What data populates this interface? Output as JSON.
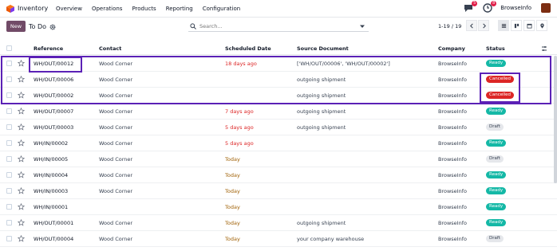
{
  "topbar": {
    "app_name": "Inventory",
    "menu": [
      "Overview",
      "Operations",
      "Products",
      "Reporting",
      "Configuration"
    ],
    "chat_badge": "5",
    "activity_badge": "8",
    "company": "BrowseInfo"
  },
  "control": {
    "new_label": "New",
    "breadcrumb": "To Do",
    "search_placeholder": "Search...",
    "pager": "1-19 / 19"
  },
  "columns": [
    "Reference",
    "Contact",
    "Scheduled Date",
    "Source Document",
    "Company",
    "Status"
  ],
  "rows": [
    {
      "ref": "WH/OUT/00012",
      "contact": "Wood Corner",
      "date": "18 days ago",
      "date_style": "red",
      "source": "['WH/OUT/00006', 'WH/OUT/00002']",
      "company": "BrowseInfo",
      "status": "Ready",
      "status_style": "ready"
    },
    {
      "ref": "WH/OUT/00006",
      "contact": "Wood Corner",
      "date": "",
      "date_style": "",
      "source": "outgoing shipment",
      "company": "BrowseInfo",
      "status": "Cancelled",
      "status_style": "cancelled"
    },
    {
      "ref": "WH/OUT/00002",
      "contact": "Wood Corner",
      "date": "",
      "date_style": "",
      "source": "outgoing shipment",
      "company": "BrowseInfo",
      "status": "Cancelled",
      "status_style": "cancelled"
    },
    {
      "ref": "WH/OUT/00007",
      "contact": "Wood Corner",
      "date": "7 days ago",
      "date_style": "red",
      "source": "outgoing shipment",
      "company": "BrowseInfo",
      "status": "Ready",
      "status_style": "ready"
    },
    {
      "ref": "WH/OUT/00003",
      "contact": "Wood Corner",
      "date": "5 days ago",
      "date_style": "red",
      "source": "outgoing shipment",
      "company": "BrowseInfo",
      "status": "Draft",
      "status_style": "draft"
    },
    {
      "ref": "WH/IN/00002",
      "contact": "Wood Corner",
      "date": "5 days ago",
      "date_style": "red",
      "source": "",
      "company": "BrowseInfo",
      "status": "Ready",
      "status_style": "ready"
    },
    {
      "ref": "WH/IN/00005",
      "contact": "Wood Corner",
      "date": "Today",
      "date_style": "yellow",
      "source": "",
      "company": "BrowseInfo",
      "status": "Draft",
      "status_style": "draft"
    },
    {
      "ref": "WH/IN/00004",
      "contact": "Wood Corner",
      "date": "Today",
      "date_style": "yellow",
      "source": "",
      "company": "BrowseInfo",
      "status": "Ready",
      "status_style": "ready"
    },
    {
      "ref": "WH/IN/00003",
      "contact": "Wood Corner",
      "date": "Today",
      "date_style": "yellow",
      "source": "",
      "company": "BrowseInfo",
      "status": "Ready",
      "status_style": "ready"
    },
    {
      "ref": "WH/IN/00001",
      "contact": "",
      "date": "Today",
      "date_style": "yellow",
      "source": "",
      "company": "BrowseInfo",
      "status": "Ready",
      "status_style": "ready"
    },
    {
      "ref": "WH/OUT/00001",
      "contact": "Wood Corner",
      "date": "Today",
      "date_style": "yellow",
      "source": "outgoing shipment",
      "company": "BrowseInfo",
      "status": "Ready",
      "status_style": "ready"
    },
    {
      "ref": "WH/OUT/00004",
      "contact": "Wood Corner",
      "date": "Today",
      "date_style": "yellow",
      "source": "your company warehouse",
      "company": "BrowseInfo",
      "status": "Draft",
      "status_style": "draft"
    }
  ]
}
